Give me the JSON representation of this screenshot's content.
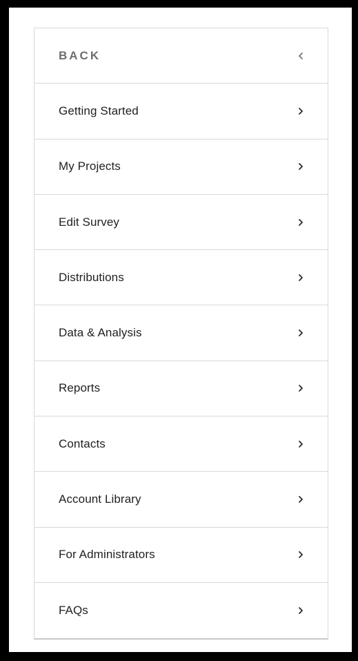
{
  "nav": {
    "back": {
      "label": "BACK",
      "icon": "chevron-left-icon"
    },
    "items": [
      {
        "label": "Getting Started",
        "icon": "chevron-right-icon"
      },
      {
        "label": "My Projects",
        "icon": "chevron-right-icon"
      },
      {
        "label": "Edit Survey",
        "icon": "chevron-right-icon"
      },
      {
        "label": "Distributions",
        "icon": "chevron-right-icon"
      },
      {
        "label": "Data & Analysis",
        "icon": "chevron-right-icon"
      },
      {
        "label": "Reports",
        "icon": "chevron-right-icon"
      },
      {
        "label": "Contacts",
        "icon": "chevron-right-icon"
      },
      {
        "label": "Account Library",
        "icon": "chevron-right-icon"
      },
      {
        "label": "For Administrators",
        "icon": "chevron-right-icon"
      },
      {
        "label": "FAQs",
        "icon": "chevron-right-icon"
      }
    ]
  },
  "colors": {
    "outer_border": "#000000",
    "background": "#ffffff",
    "divider": "#d8d8d8",
    "back_text": "#6e6e6e",
    "item_text": "#1f1f1f",
    "chevron": "#2a2a2a",
    "back_chevron": "#6e6e6e"
  }
}
